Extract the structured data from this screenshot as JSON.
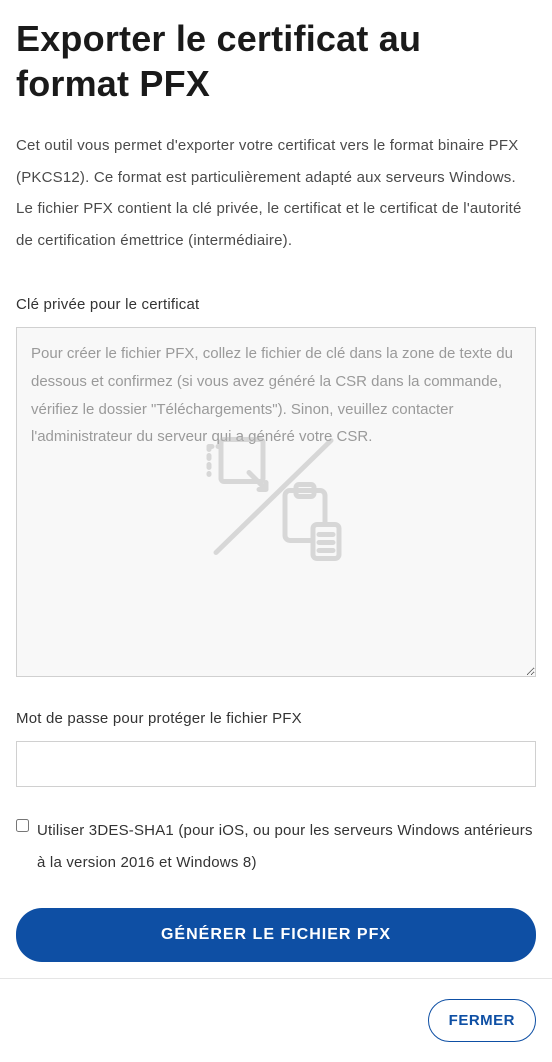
{
  "title": "Exporter le certificat au format PFX",
  "description": "Cet outil vous permet d'exporter votre certificat vers le format binaire PFX (PKCS12). Ce format est particulièrement adapté aux serveurs Windows. Le fichier PFX contient la clé privée, le certificat et le certificat de l'autorité de certification émettrice (intermédiaire).",
  "form": {
    "privateKey": {
      "label": "Clé privée pour le certificat",
      "placeholder": "Pour créer le fichier PFX, collez le fichier de clé dans la zone de texte du dessous et confirmez (si vous avez généré la CSR dans la commande, vérifiez le dossier \"Téléchargements\"). Sinon, veuillez contacter l'administrateur du serveur qui a généré votre CSR.",
      "value": ""
    },
    "password": {
      "label": "Mot de passe pour protéger le fichier PFX",
      "value": ""
    },
    "checkbox": {
      "label": "Utiliser 3DES-SHA1 (pour iOS, ou pour les serveurs Windows antérieurs à la version 2016 et Windows 8)",
      "checked": false
    },
    "submit": "GÉNÉRER LE FICHIER PFX"
  },
  "footer": {
    "close": "FERMER"
  },
  "colors": {
    "primary": "#0e4fa4",
    "iconGray": "#b8b8b8"
  }
}
